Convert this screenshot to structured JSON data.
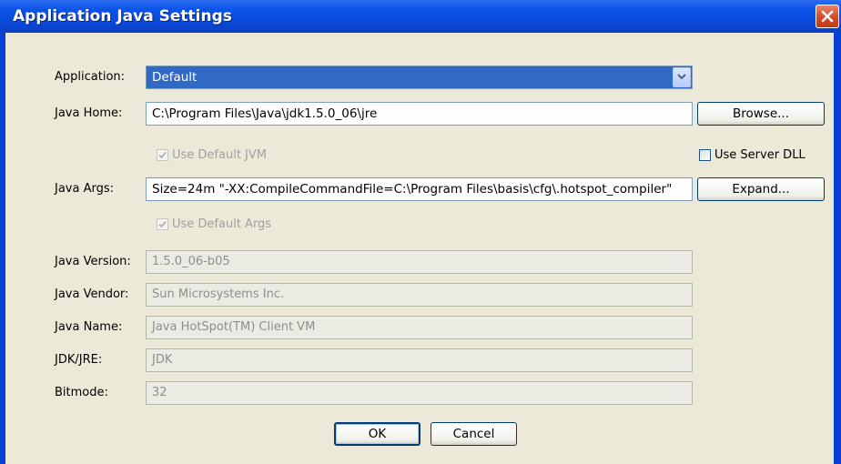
{
  "window": {
    "title": "Application Java Settings"
  },
  "form": {
    "application_label": "Application:",
    "application_value": "Default",
    "java_home_label": "Java Home:",
    "java_home_value": "C:\\Program Files\\Java\\jdk1.5.0_06\\jre",
    "browse_label": "Browse...",
    "use_default_jvm_label": "Use Default JVM",
    "use_default_jvm_checked": true,
    "use_server_dll_label": "Use Server DLL",
    "use_server_dll_checked": false,
    "java_args_label": "Java Args:",
    "java_args_value": "Size=24m \"-XX:CompileCommandFile=C:\\Program Files\\basis\\cfg\\.hotspot_compiler\"",
    "expand_label": "Expand...",
    "use_default_args_label": "Use Default Args",
    "use_default_args_checked": true,
    "java_version_label": "Java Version:",
    "java_version_value": "1.5.0_06-b05",
    "java_vendor_label": "Java Vendor:",
    "java_vendor_value": "Sun Microsystems Inc.",
    "java_name_label": "Java Name:",
    "java_name_value": "Java HotSpot(TM) Client VM",
    "jdk_jre_label": "JDK/JRE:",
    "jdk_jre_value": "JDK",
    "bitmode_label": "Bitmode:",
    "bitmode_value": "32"
  },
  "buttons": {
    "ok": "OK",
    "cancel": "Cancel"
  },
  "icons": {
    "close": "close-icon",
    "dropdown": "chevron-down-icon",
    "check": "checkmark-icon"
  },
  "colors": {
    "titlebar": "#0b53e8",
    "selection": "#316ac5",
    "dialog_bg": "#ece9d8",
    "close_button": "#d44420"
  }
}
